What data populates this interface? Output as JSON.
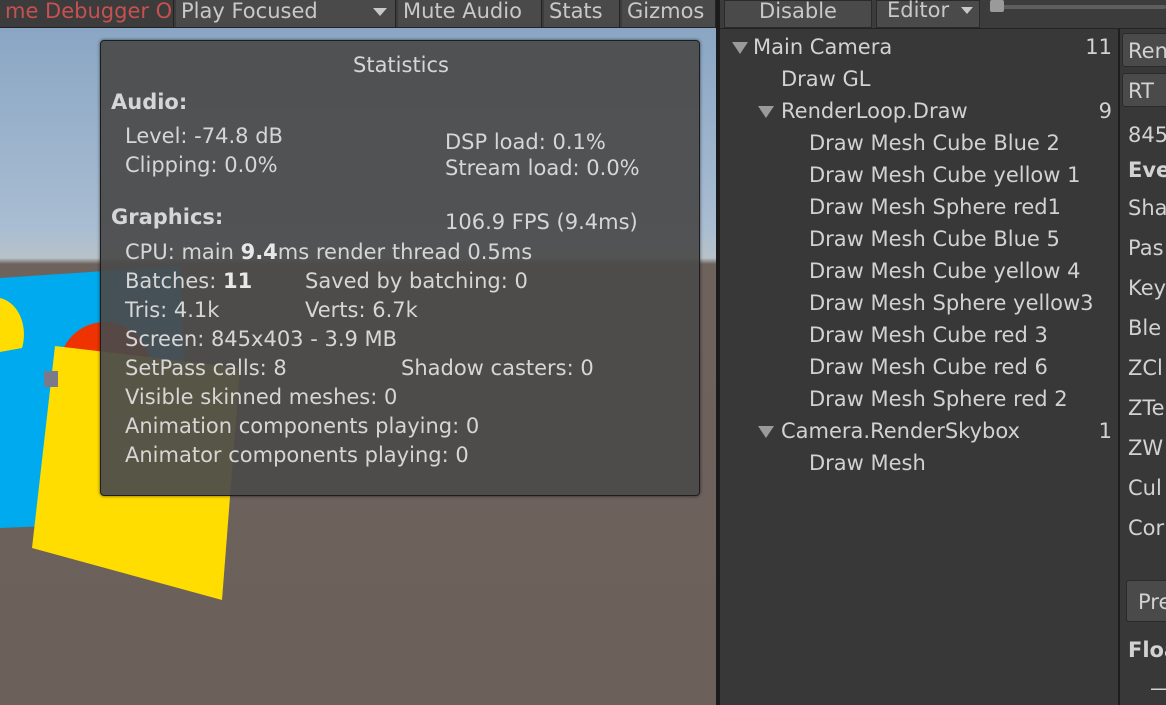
{
  "game_toolbar": {
    "debugger_label": "me Debugger On",
    "play_focused": "Play Focused",
    "mute_audio": "Mute Audio",
    "stats": "Stats",
    "gizmos": "Gizmos"
  },
  "stats": {
    "title": "Statistics",
    "audio_header": "Audio:",
    "level": "Level: -74.8 dB",
    "clipping": "Clipping: 0.0%",
    "dsp_load": "DSP load: 0.1%",
    "stream_load": "Stream load: 0.0%",
    "graphics_header": "Graphics:",
    "fps": "106.9 FPS (9.4ms)",
    "cpu_prefix": "CPU: main ",
    "cpu_main": "9.4",
    "cpu_suffix": "ms  render thread 0.5ms",
    "batches_prefix": "Batches: ",
    "batches_value": "11",
    "saved_by_batching": "Saved by batching: 0",
    "tris": "Tris: 4.1k",
    "verts": "Verts: 6.7k",
    "screen": "Screen: 845x403 - 3.9 MB",
    "setpass": "SetPass calls: 8",
    "shadow_casters": "Shadow casters: 0",
    "skinned": "Visible skinned meshes: 0",
    "animation": "Animation components playing: 0",
    "animator": "Animator components playing: 0"
  },
  "frame_debugger": {
    "disable": "Disable",
    "editor": "Editor",
    "tree": [
      {
        "label": "Main Camera",
        "count": "11",
        "expanded": true
      },
      {
        "label": "Draw GL",
        "count": ""
      },
      {
        "label": "RenderLoop.Draw",
        "count": "9",
        "expanded": true
      },
      {
        "label": "Draw Mesh Cube Blue 2",
        "count": ""
      },
      {
        "label": "Draw Mesh Cube yellow 1",
        "count": ""
      },
      {
        "label": "Draw Mesh Sphere red1",
        "count": ""
      },
      {
        "label": "Draw Mesh Cube Blue 5",
        "count": ""
      },
      {
        "label": "Draw Mesh Cube yellow 4",
        "count": ""
      },
      {
        "label": "Draw Mesh Sphere yellow3",
        "count": ""
      },
      {
        "label": "Draw Mesh Cube red 3",
        "count": ""
      },
      {
        "label": "Draw Mesh Cube red 6",
        "count": ""
      },
      {
        "label": "Draw Mesh Sphere red 2",
        "count": ""
      },
      {
        "label": "Camera.RenderSkybox",
        "count": "1",
        "expanded": true
      },
      {
        "label": "Draw Mesh",
        "count": ""
      }
    ],
    "details": [
      "Ren",
      "RT",
      "845",
      "Eve",
      "Sha",
      "Pas",
      "Key",
      "Ble",
      "ZCl",
      "ZTe",
      "ZW",
      "Cul",
      "Cor",
      "Pre",
      "Floa",
      "—"
    ]
  },
  "colors": {
    "blue": "#00aaee",
    "yellow": "#ffdd00",
    "red": "#ee3300",
    "debugger_red": "#c85050"
  }
}
